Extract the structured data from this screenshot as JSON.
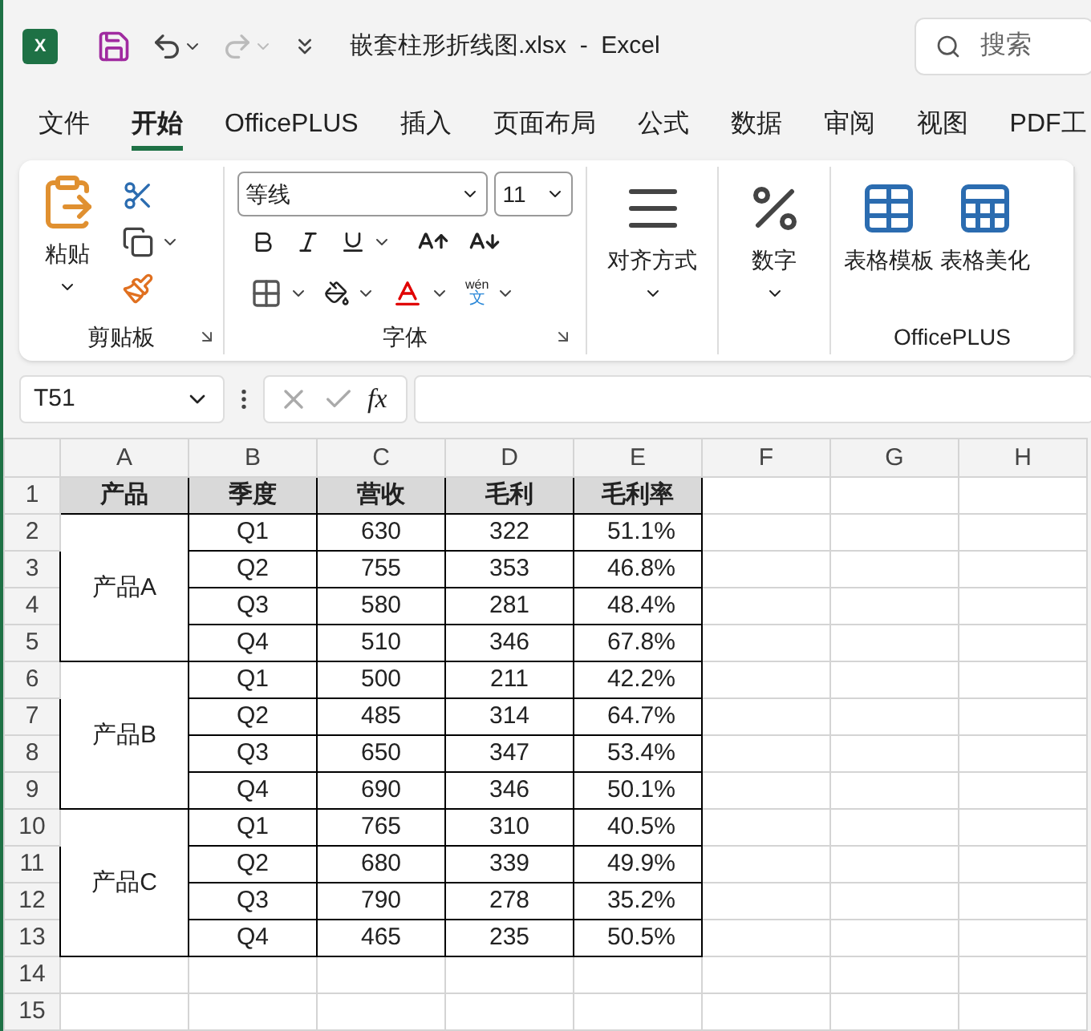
{
  "title_bar": {
    "logo_letter": "X",
    "document_title": "嵌套柱形折线图.xlsx  -  Excel",
    "search": {
      "placeholder": "搜索"
    }
  },
  "tabs": [
    {
      "label": "文件",
      "selected": false
    },
    {
      "label": "开始",
      "selected": true
    },
    {
      "label": "OfficePLUS",
      "selected": false
    },
    {
      "label": "插入",
      "selected": false
    },
    {
      "label": "页面布局",
      "selected": false
    },
    {
      "label": "公式",
      "selected": false
    },
    {
      "label": "数据",
      "selected": false
    },
    {
      "label": "审阅",
      "selected": false
    },
    {
      "label": "视图",
      "selected": false
    },
    {
      "label": "PDF工",
      "selected": false
    }
  ],
  "ribbon": {
    "clipboard": {
      "paste": "粘贴",
      "label": "剪贴板"
    },
    "font": {
      "font_name": "等线",
      "font_size": "11",
      "phonetic": [
        "wén",
        "文"
      ],
      "label": "字体"
    },
    "alignment": {
      "label": "对齐方式"
    },
    "number": {
      "label": "数字"
    },
    "officeplus": {
      "buttons": [
        "表格模板",
        "表格美化"
      ],
      "label": "OfficePLUS"
    }
  },
  "formula_bar": {
    "name_box": "T51",
    "fx": "fx"
  },
  "sheet": {
    "columns": [
      "A",
      "B",
      "C",
      "D",
      "E",
      "F",
      "G",
      "H"
    ],
    "row_numbers": [
      "1",
      "2",
      "3",
      "4",
      "5",
      "6",
      "7",
      "8",
      "9",
      "10",
      "11",
      "12",
      "13",
      "14",
      "15"
    ],
    "header": [
      "产品",
      "季度",
      "营收",
      "毛利",
      "毛利率"
    ],
    "groups": [
      {
        "product": "产品A",
        "rows": [
          [
            "Q1",
            "630",
            "322",
            "51.1%"
          ],
          [
            "Q2",
            "755",
            "353",
            "46.8%"
          ],
          [
            "Q3",
            "580",
            "281",
            "48.4%"
          ],
          [
            "Q4",
            "510",
            "346",
            "67.8%"
          ]
        ]
      },
      {
        "product": "产品B",
        "rows": [
          [
            "Q1",
            "500",
            "211",
            "42.2%"
          ],
          [
            "Q2",
            "485",
            "314",
            "64.7%"
          ],
          [
            "Q3",
            "650",
            "347",
            "53.4%"
          ],
          [
            "Q4",
            "690",
            "346",
            "50.1%"
          ]
        ]
      },
      {
        "product": "产品C",
        "rows": [
          [
            "Q1",
            "765",
            "310",
            "40.5%"
          ],
          [
            "Q2",
            "680",
            "339",
            "49.9%"
          ],
          [
            "Q3",
            "790",
            "278",
            "35.2%"
          ],
          [
            "Q4",
            "465",
            "235",
            "50.5%"
          ]
        ]
      }
    ]
  }
}
